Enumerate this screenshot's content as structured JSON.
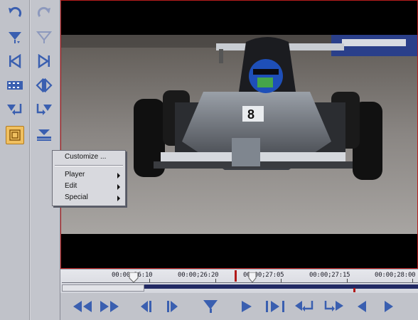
{
  "context_menu": {
    "customize_label": "Customize ...",
    "items": [
      {
        "label": "Player"
      },
      {
        "label": "Edit"
      },
      {
        "label": "Special"
      }
    ]
  },
  "timeline": {
    "timecodes": [
      "00:00;26:10",
      "00:00;26:20",
      "00:00;27:05",
      "00:00;27:15",
      "00:00;28:00"
    ]
  },
  "colors": {
    "icon_blue": "#3a5fb0",
    "monitor_border": "#b71c1c",
    "active_tool": "#f0c060"
  },
  "left_toolbar_icons": [
    "undo-icon",
    "set-mark-in-icon",
    "trim-left-icon",
    "filmstrip-icon",
    "insert-edit-icon",
    "safe-area-toggle-icon"
  ],
  "right_toolbar_icons": [
    "redo-icon",
    "clear-mark-icon",
    "trim-right-icon",
    "split-icon",
    "overwrite-edit-icon",
    "lift-icon"
  ],
  "transport_icons": [
    "rewind-icon",
    "fast-forward-icon",
    "previous-frame-icon",
    "next-frame-icon",
    "set-marker-icon",
    "play-icon",
    "play-to-out-icon",
    "go-to-in-icon",
    "go-to-out-icon",
    "step-back-icon",
    "step-forward-icon"
  ]
}
